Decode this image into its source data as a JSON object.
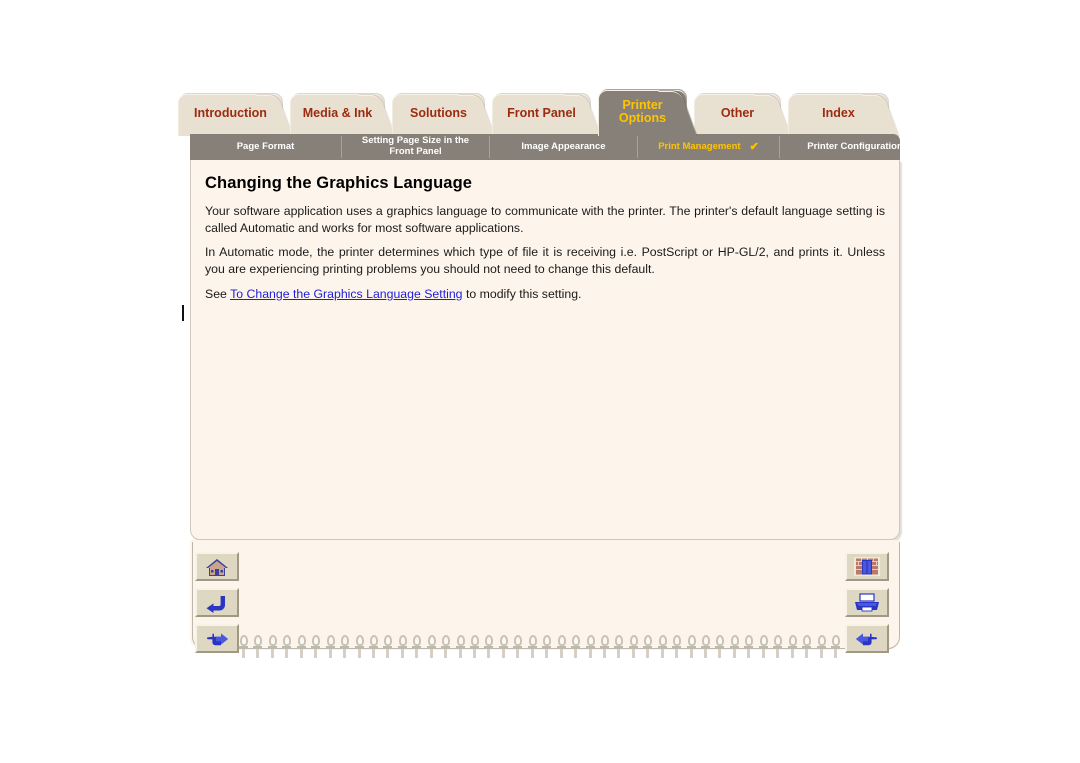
{
  "tabs": [
    {
      "label": "Introduction",
      "selected": false,
      "name": "tab-introduction"
    },
    {
      "label": "Media & Ink",
      "selected": false,
      "name": "tab-media-ink"
    },
    {
      "label": "Solutions",
      "selected": false,
      "name": "tab-solutions"
    },
    {
      "label": "Front Panel",
      "selected": false,
      "name": "tab-front-panel"
    },
    {
      "label": "Printer\nOptions",
      "selected": true,
      "name": "tab-printer-options"
    },
    {
      "label": "Other",
      "selected": false,
      "name": "tab-other"
    },
    {
      "label": "Index",
      "selected": false,
      "name": "tab-index"
    }
  ],
  "tab_labels": {
    "introduction": "Introduction",
    "media_ink": "Media & Ink",
    "solutions": "Solutions",
    "front_panel": "Front Panel",
    "printer_options_line1": "Printer",
    "printer_options_line2": "Options",
    "other": "Other",
    "index": "Index"
  },
  "subtabs": {
    "page_format": "Page Format",
    "setting_page_size_line1": "Setting Page Size in the",
    "setting_page_size_line2": "Front Panel",
    "image_appearance": "Image Appearance",
    "print_management": "Print Management",
    "print_management_check": "✔",
    "printer_configuration": "Printer Configuration"
  },
  "content": {
    "title": "Changing the Graphics Language",
    "paragraph1": "Your software application uses a graphics language to communicate with the printer. The printer's default language setting is called Automatic and works for most software applications.",
    "paragraph2": "In Automatic mode, the printer determines which type of file it is receiving i.e. PostScript or HP-GL/2, and prints it. Unless you are experiencing printing problems you should not need to change this default.",
    "paragraph3_before": "See ",
    "paragraph3_link": "To Change the Graphics Language Setting",
    "paragraph3_after": " to modify this setting."
  },
  "nav": {
    "home": "home-icon",
    "back": "back-arrow-icon",
    "previous": "previous-hand-icon",
    "exit": "exit-door-icon",
    "print": "printer-icon",
    "next": "next-hand-icon"
  },
  "colors": {
    "tab_unselected_bg": "#e8e0d0",
    "tab_unselected_text": "#9c2b10",
    "tab_selected_bg": "#878078",
    "tab_selected_text": "#ffc400",
    "subbar_bg": "#878078",
    "subtab_text": "#ffffff",
    "subtab_active_text": "#ffc400",
    "sheet_bg": "#fdf5ec",
    "link": "#1d1dd8",
    "button_face": "#ded7c2",
    "page_bg": "#ffffff"
  }
}
